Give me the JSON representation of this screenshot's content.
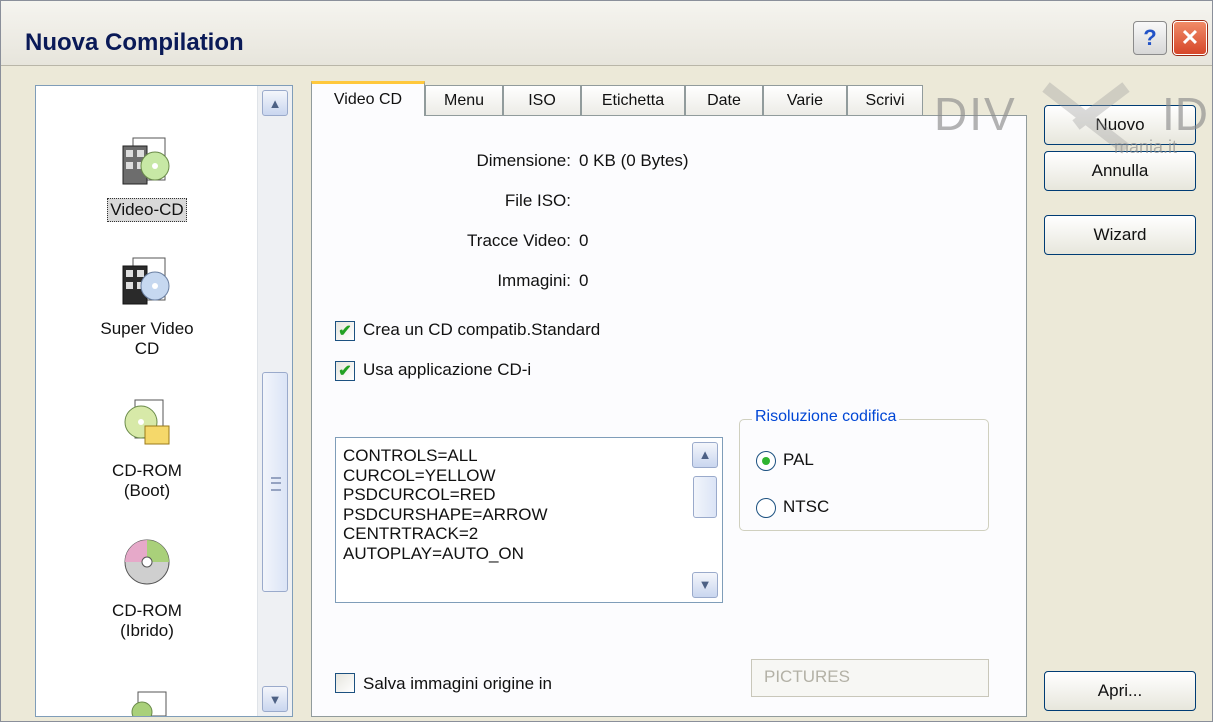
{
  "window": {
    "title": "Nuova Compilation"
  },
  "title_buttons": {
    "help": "?",
    "close": "✕"
  },
  "compilation_types": [
    {
      "label": "Video-CD",
      "icon": "video-cd-icon",
      "selected": true
    },
    {
      "label": "Super Video CD",
      "icon": "super-video-cd-icon"
    },
    {
      "label": "CD-ROM (Boot)",
      "icon": "cd-rom-boot-icon"
    },
    {
      "label": "CD-ROM (Ibrido)",
      "icon": "cd-rom-hybrid-icon"
    }
  ],
  "tabs": [
    "Video CD",
    "Menu",
    "ISO",
    "Etichetta",
    "Date",
    "Varie",
    "Scrivi"
  ],
  "info": {
    "size_label": "Dimensione:",
    "size_value": "0 KB (0 Bytes)",
    "iso_label": "File ISO:",
    "iso_value": "",
    "tracks_label": "Tracce Video:",
    "tracks_value": "0",
    "images_label": "Immagini:",
    "images_value": "0"
  },
  "options": {
    "standard_cd": {
      "label": "Crea un CD compatib.Standard",
      "checked": true
    },
    "cdi_app": {
      "label": "Usa applicazione CD-i",
      "checked": true
    },
    "save_images": {
      "label": "Salva immagini origine in",
      "checked": false
    }
  },
  "config_lines": [
    "CONTROLS=ALL",
    "CURCOL=YELLOW",
    "PSDCURCOL=RED",
    "PSDCURSHAPE=ARROW",
    "CENTRTRACK=2",
    "AUTOPLAY=AUTO_ON"
  ],
  "encoding": {
    "title": "Risoluzione codifica",
    "pal": "PAL",
    "ntsc": "NTSC",
    "selected": "PAL"
  },
  "pictures_field": {
    "value": "PICTURES"
  },
  "buttons": {
    "new": "Nuovo",
    "cancel": "Annulla",
    "wizard": "Wizard",
    "open": "Apri..."
  },
  "watermark": {
    "line1": "DIV",
    "line2": "ID",
    "line3": "mania.it"
  },
  "colors": {
    "group_title": "#0046d5",
    "active_tab_accent": "#ffc83c",
    "check": "#21a121"
  }
}
